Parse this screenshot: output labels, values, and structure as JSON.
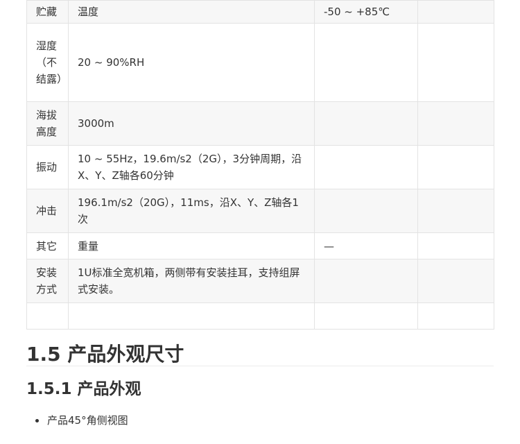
{
  "table": {
    "rows": [
      {
        "c1": "贮藏",
        "c2": "温度",
        "c3": "-50 ~ +85℃",
        "c4": ""
      },
      {
        "c1": "湿度（不结露）",
        "c2": "20 ~ 90%RH",
        "c3": "",
        "c4": ""
      },
      {
        "c1": "海拔高度",
        "c2": "3000m",
        "c3": "",
        "c4": ""
      },
      {
        "c1": "振动",
        "c2": "10 ~ 55Hz，19.6m/s2（2G），3分钟周期，沿X、Y、Z轴各60分钟",
        "c3": "",
        "c4": ""
      },
      {
        "c1": "冲击",
        "c2": "196.1m/s2（20G），11ms，沿X、Y、Z轴各1次",
        "c3": "",
        "c4": ""
      },
      {
        "c1": "其它",
        "c2": "重量",
        "c3": "—",
        "c4": ""
      },
      {
        "c1": "安装方式",
        "c2": "1U标准全宽机箱，两侧带有安装挂耳，支持组屏式安装。",
        "c3": "",
        "c4": ""
      },
      {
        "c1": "",
        "c2": "",
        "c3": "",
        "c4": ""
      }
    ]
  },
  "section": {
    "title": "1.5 产品外观尺寸",
    "subsection_title": "1.5.1 产品外观",
    "bullets": [
      "产品45°角侧视图"
    ]
  }
}
